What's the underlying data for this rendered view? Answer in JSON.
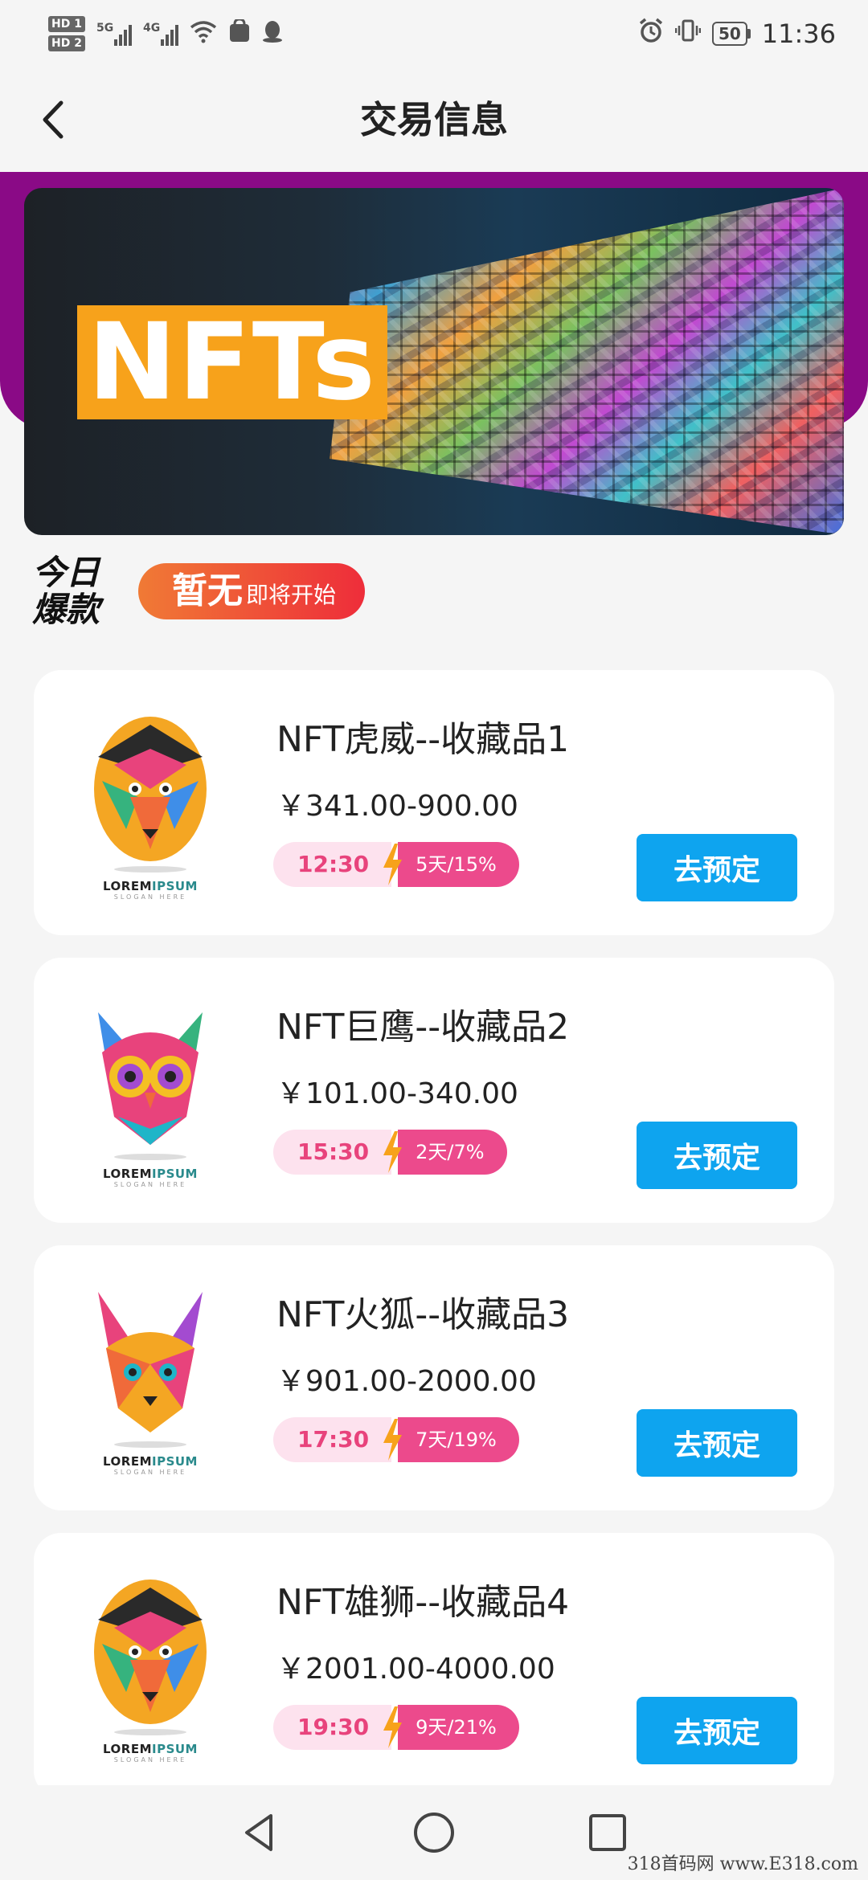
{
  "status_bar": {
    "hd1": "HD 1",
    "hd2": "HD 2",
    "net1": "5G",
    "net2": "4G",
    "battery": "50",
    "time": "11:36"
  },
  "header": {
    "title": "交易信息"
  },
  "banner": {
    "label": "NFTs"
  },
  "today_hot": {
    "logo_line1": "今日",
    "logo_line2": "爆款",
    "status": "暂无",
    "status_note": "即将开始"
  },
  "products": [
    {
      "name": "NFT虎威--收藏品1",
      "price": "￥341.00-900.00",
      "time": "12:30",
      "rate": "5天/15%",
      "button": "去预定",
      "icon": "tiger-logo",
      "brand_a": "LOREM",
      "brand_b": "IPSUM",
      "slogan": "SLOGAN HERE"
    },
    {
      "name": "NFT巨鹰--收藏品2",
      "price": "￥101.00-340.00",
      "time": "15:30",
      "rate": "2天/7%",
      "button": "去预定",
      "icon": "owl-logo",
      "brand_a": "LOREM",
      "brand_b": "IPSUM",
      "slogan": "SLOGAN HERE"
    },
    {
      "name": "NFT火狐--收藏品3",
      "price": "￥901.00-2000.00",
      "time": "17:30",
      "rate": "7天/19%",
      "button": "去预定",
      "icon": "lynx-logo",
      "brand_a": "LOREM",
      "brand_b": "IPSUM",
      "slogan": "SLOGAN HERE"
    },
    {
      "name": "NFT雄狮--收藏品4",
      "price": "￥2001.00-4000.00",
      "time": "19:30",
      "rate": "9天/21%",
      "button": "去预定",
      "icon": "tiger-logo",
      "brand_a": "LOREM",
      "brand_b": "IPSUM",
      "slogan": "SLOGAN HERE"
    }
  ],
  "watermark": "318首码网 www.E318.com",
  "colors": {
    "accent_blue": "#0ea4ef",
    "purple_band": "#8a0a86",
    "banner_orange": "#f7a21b",
    "tag_pink": "#ec4a8c"
  }
}
